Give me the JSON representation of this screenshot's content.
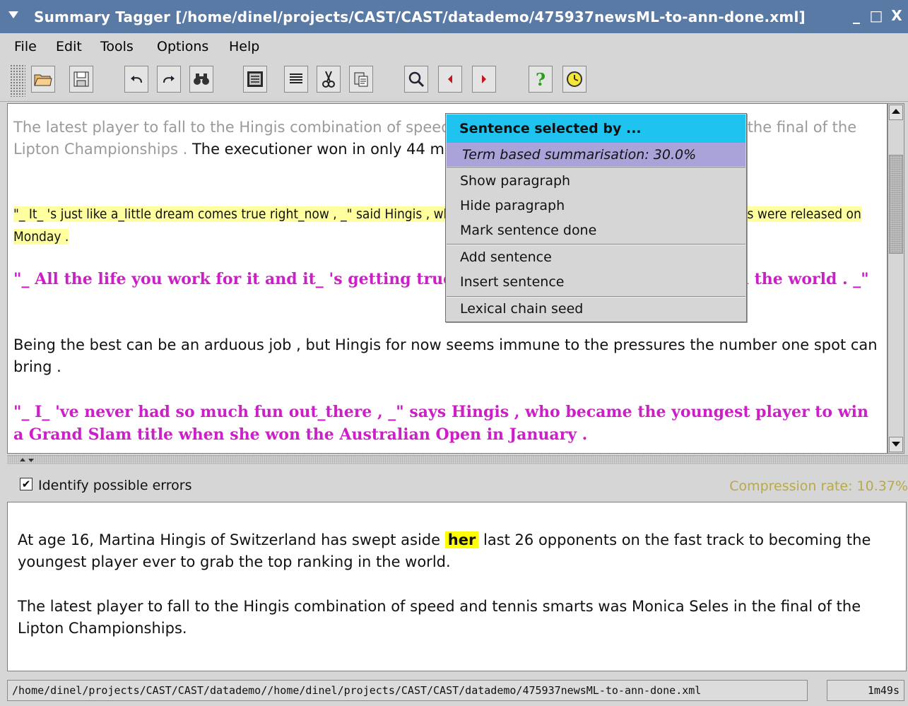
{
  "window": {
    "title": "Summary Tagger [/home/dinel/projects/CAST/CAST/datademo/475937newsML-to-ann-done.xml]",
    "minimize": "_",
    "maximize": "□",
    "close": "X"
  },
  "menubar": {
    "items": [
      "File",
      "Edit",
      "Tools",
      "Options",
      "Help"
    ]
  },
  "toolbar": {
    "buttons": [
      "open-folder-icon",
      "save-icon",
      "undo-icon",
      "redo-icon",
      "find-binoculars-icon",
      "summary-view-icon",
      "align-text-icon",
      "cut-icon",
      "paste-icon",
      "zoom-search-icon",
      "previous-arrow-icon",
      "next-arrow-icon",
      "help-icon",
      "timer-icon"
    ],
    "help_glyph": "?"
  },
  "editor": {
    "p1_gray": "The latest player to fall to the Hingis combination of speed and tennis smarts was Monica Seles in the final of the Lipton Championships .",
    "p1_rest": " The executioner won in only 44 minutes in a 6-2 6-1 romp .",
    "p2": "\"_ It_ 's just like a_little dream comes true right_now , _\" said Hingis , who became the queen of tennis when new rankings were released on Monday .",
    "p3": "\"_ All the life you work for it and it_ 's getting true , you're the number one player in the world . _\"",
    "p4": "Being the best can be an arduous job , but Hingis for now seems immune to the pressures the number one spot can bring .",
    "p5": "\"_ I_ 've never had so much fun out_there , _\" says Hingis , who became the youngest player to win a Grand Slam title when she won the Australian Open in January ."
  },
  "popup": {
    "header": "Sentence selected by ...",
    "method": "Term based summarisation: 30.0%",
    "items_group1": [
      "Show paragraph",
      "Hide paragraph",
      "Mark sentence done"
    ],
    "items_group2": [
      "Add sentence",
      "Insert sentence"
    ],
    "items_group3": [
      "Lexical chain seed"
    ]
  },
  "options": {
    "identify_errors_label": "Identify possible errors",
    "identify_errors_checked": true,
    "checkmark": "✔",
    "compression_rate": "Compression rate: 10.37%"
  },
  "summary": {
    "s1_before": "At age 16, Martina Hingis of Switzerland has swept aside ",
    "s1_highlight": "her",
    "s1_after": " last 26 opponents on the fast track to becoming the youngest player ever to grab the top ranking in the world.",
    "s2": "The latest player to fall to the Hingis combination of speed and tennis smarts was Monica Seles in the final of the Lipton Championships."
  },
  "statusbar": {
    "path": "/home/dinel/projects/CAST/CAST/datademo//home/dinel/projects/CAST/CAST/datademo/475937newsML-to-ann-done.xml",
    "elapsed": "1m49s"
  },
  "colors": {
    "titlebar": "#5a7aa6",
    "popup_header": "#1ec3f0",
    "popup_method": "#a9a3d9",
    "pink_text": "#cc1fc7",
    "yellow_highlight": "#ffff9f",
    "compression_text": "#b8a94b"
  }
}
